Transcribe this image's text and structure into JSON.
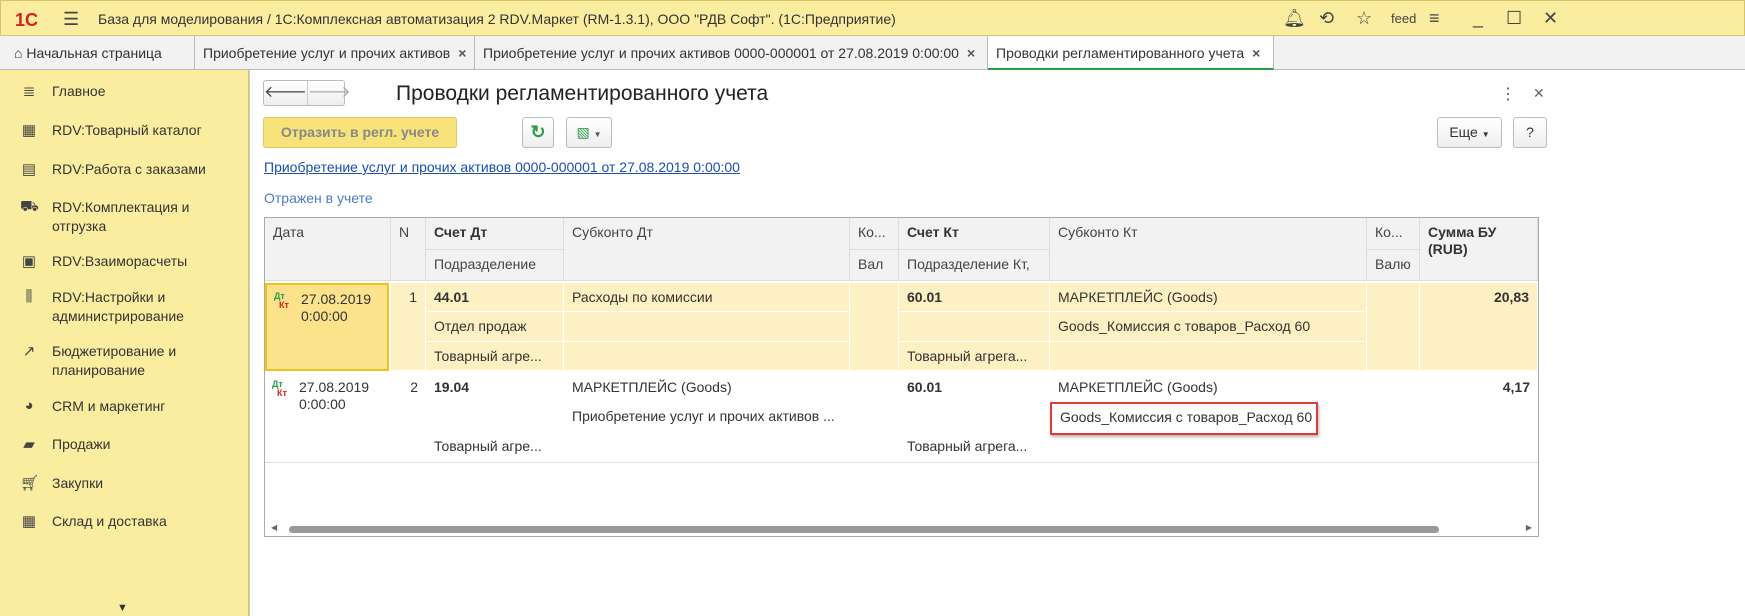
{
  "app": {
    "logo": "1С",
    "title": "База для моделирования / 1С:Комплексная автоматизация 2 RDV.Маркет (RM-1.3.1), ООО \"РДВ Софт\".  (1С:Предприятие)",
    "user": "feed"
  },
  "tabs": [
    {
      "label": "Начальная страница"
    },
    {
      "label": "Приобретение услуг и прочих активов"
    },
    {
      "label": "Приобретение услуг и прочих активов 0000-000001 от 27.08.2019 0:00:00"
    },
    {
      "label": "Проводки регламентированного учета"
    }
  ],
  "sidebar": {
    "items": [
      {
        "label": "Главное"
      },
      {
        "label": "RDV:Товарный каталог"
      },
      {
        "label": "RDV:Работа с заказами"
      },
      {
        "label": "RDV:Комплектация и отгрузка"
      },
      {
        "label": "RDV:Взаиморасчеты"
      },
      {
        "label": "RDV:Настройки и администрирование"
      },
      {
        "label": "Бюджетирование и планирование"
      },
      {
        "label": "CRM и маркетинг"
      },
      {
        "label": "Продажи"
      },
      {
        "label": "Закупки"
      },
      {
        "label": "Склад и доставка"
      }
    ]
  },
  "form": {
    "title": "Проводки регламентированного учета",
    "reflect_button": "Отразить в регл. учете",
    "more_button": "Еще",
    "help_button": "?",
    "doc_link": "Приобретение услуг и прочих активов 0000-000001 от 27.08.2019 0:00:00",
    "status": "Отражен в учете"
  },
  "table": {
    "headers": {
      "date": "Дата",
      "n": "N",
      "acc_dt": "Счет Дт",
      "dept": "Подразделение",
      "sub_dt": "Субконто Дт",
      "ko1": "Ко...",
      "val1": "Вал",
      "acc_kt": "Счет Кт",
      "dept_kt": "Подразделение Кт,",
      "sub_kt": "Субконто Кт",
      "ko2": "Ко...",
      "val2": "Валю",
      "sum": "Сумма БУ (RUB)"
    },
    "dtkt": {
      "dt": "Дт",
      "kt": "Кт"
    },
    "rows": [
      {
        "date": "27.08.2019",
        "time": "0:00:00",
        "n": "1",
        "acc_dt": "44.01",
        "dept": "Отдел продаж",
        "dt3": "Товарный агре...",
        "sub_dt1": "Расходы по комиссии",
        "sub_dt2": "",
        "acc_kt": "60.01",
        "kt3": "Товарный агрега...",
        "sub_kt1": "МАРКЕТПЛЕЙС (Goods)",
        "sub_kt2": "Goods_Комиссия с товаров_Расход 60",
        "sum": "20,83"
      },
      {
        "date": "27.08.2019",
        "time": "0:00:00",
        "n": "2",
        "acc_dt": "19.04",
        "dept": "",
        "dt3": "Товарный агре...",
        "sub_dt1": "МАРКЕТПЛЕЙС (Goods)",
        "sub_dt2": "Приобретение услуг и прочих активов ...",
        "acc_kt": "60.01",
        "kt3": "Товарный агрега...",
        "sub_kt1": "МАРКЕТПЛЕЙС (Goods)",
        "sub_kt2": "Goods_Комиссия с товаров_Расход 60",
        "sum": "4,17"
      }
    ]
  }
}
